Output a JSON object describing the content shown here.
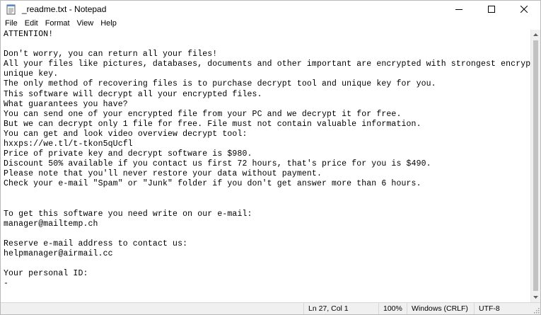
{
  "window": {
    "title": "_readme.txt - Notepad",
    "icons": {
      "app": "notepad-icon",
      "minimize": "minimize-icon",
      "maximize": "maximize-icon",
      "close": "close-icon"
    }
  },
  "menu": {
    "file": "File",
    "edit": "Edit",
    "format": "Format",
    "view": "View",
    "help": "Help"
  },
  "document": {
    "lines": [
      "ATTENTION!",
      "",
      "Don't worry, you can return all your files!",
      "All your files like pictures, databases, documents and other important are encrypted with strongest encryption and",
      "unique key.",
      "The only method of recovering files is to purchase decrypt tool and unique key for you.",
      "This software will decrypt all your encrypted files.",
      "What guarantees you have?",
      "You can send one of your encrypted file from your PC and we decrypt it for free.",
      "But we can decrypt only 1 file for free. File must not contain valuable information.",
      "You can get and look video overview decrypt tool:",
      "hxxps://we.tl/t-tkon5qUcfl",
      "Price of private key and decrypt software is $980.",
      "Discount 50% available if you contact us first 72 hours, that's price for you is $490.",
      "Please note that you'll never restore your data without payment.",
      "Check your e-mail \"Spam\" or \"Junk\" folder if you don't get answer more than 6 hours.",
      "",
      "",
      "To get this software you need write on our e-mail:",
      "manager@mailtemp.ch",
      "",
      "Reserve e-mail address to contact us:",
      "helpmanager@airmail.cc",
      "",
      "Your personal ID:",
      "-"
    ]
  },
  "status": {
    "position": "Ln 27, Col 1",
    "zoom": "100%",
    "line_ending": "Windows (CRLF)",
    "encoding": "UTF-8"
  }
}
